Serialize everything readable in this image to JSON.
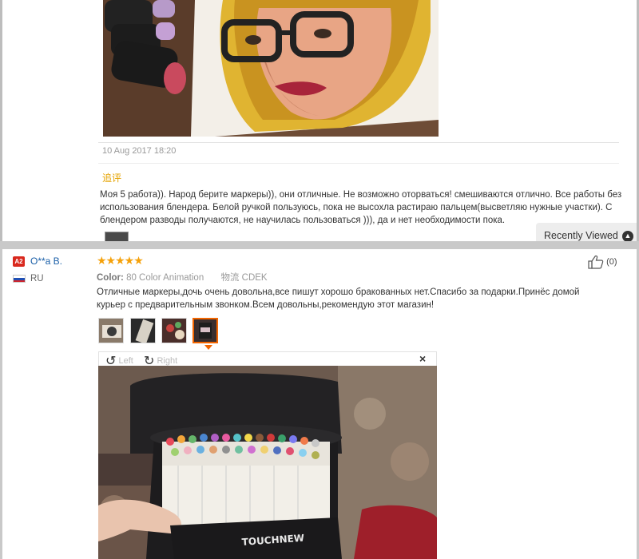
{
  "previous_review": {
    "date": "10 Aug 2017 18:20",
    "followup_label": "追评",
    "followup_text": "Моя 5 работа)). Народ берите маркеры)), они отличные. Не возможно оторваться! смешиваются отлично. Все работы без использования блендера. Белой ручкой пользуюсь, пока не высохла растираю пальцем(высветляю нужные участки). С блендером разводы получаются, не научилась пользоваться ))), да и нет необходимости пока."
  },
  "recently_viewed": {
    "label": "Recently Viewed",
    "icon": "chevron-up-icon"
  },
  "review": {
    "badge": "A2",
    "reviewer_name": "O**a B.",
    "country_code": "RU",
    "rating": 5,
    "stars_text": "★★★★★",
    "color_label": "Color:",
    "color_value": "80 Color Animation",
    "shipping_label": "物流",
    "shipping_value": "CDEK",
    "helpful_count": "(0)",
    "text": "Отличные маркеры,дочь очень довольна,все пишут хорошо бракованных нет.Спасибо за подарки.Принёс домой курьер с предварительным звонком.Всем довольны,рекомендую этот магазин!",
    "thumbnails": 4,
    "active_thumbnail": 4
  },
  "viewer": {
    "rotate_left": "Left",
    "rotate_right": "Right",
    "close": "×",
    "photo_brand": "TOUCHNEW"
  },
  "colors": {
    "star": "#f5a10a",
    "name_link": "#1a5fa8",
    "followup": "#e5a300",
    "badge": "#d9281d",
    "active_thumb": "#f26500"
  }
}
